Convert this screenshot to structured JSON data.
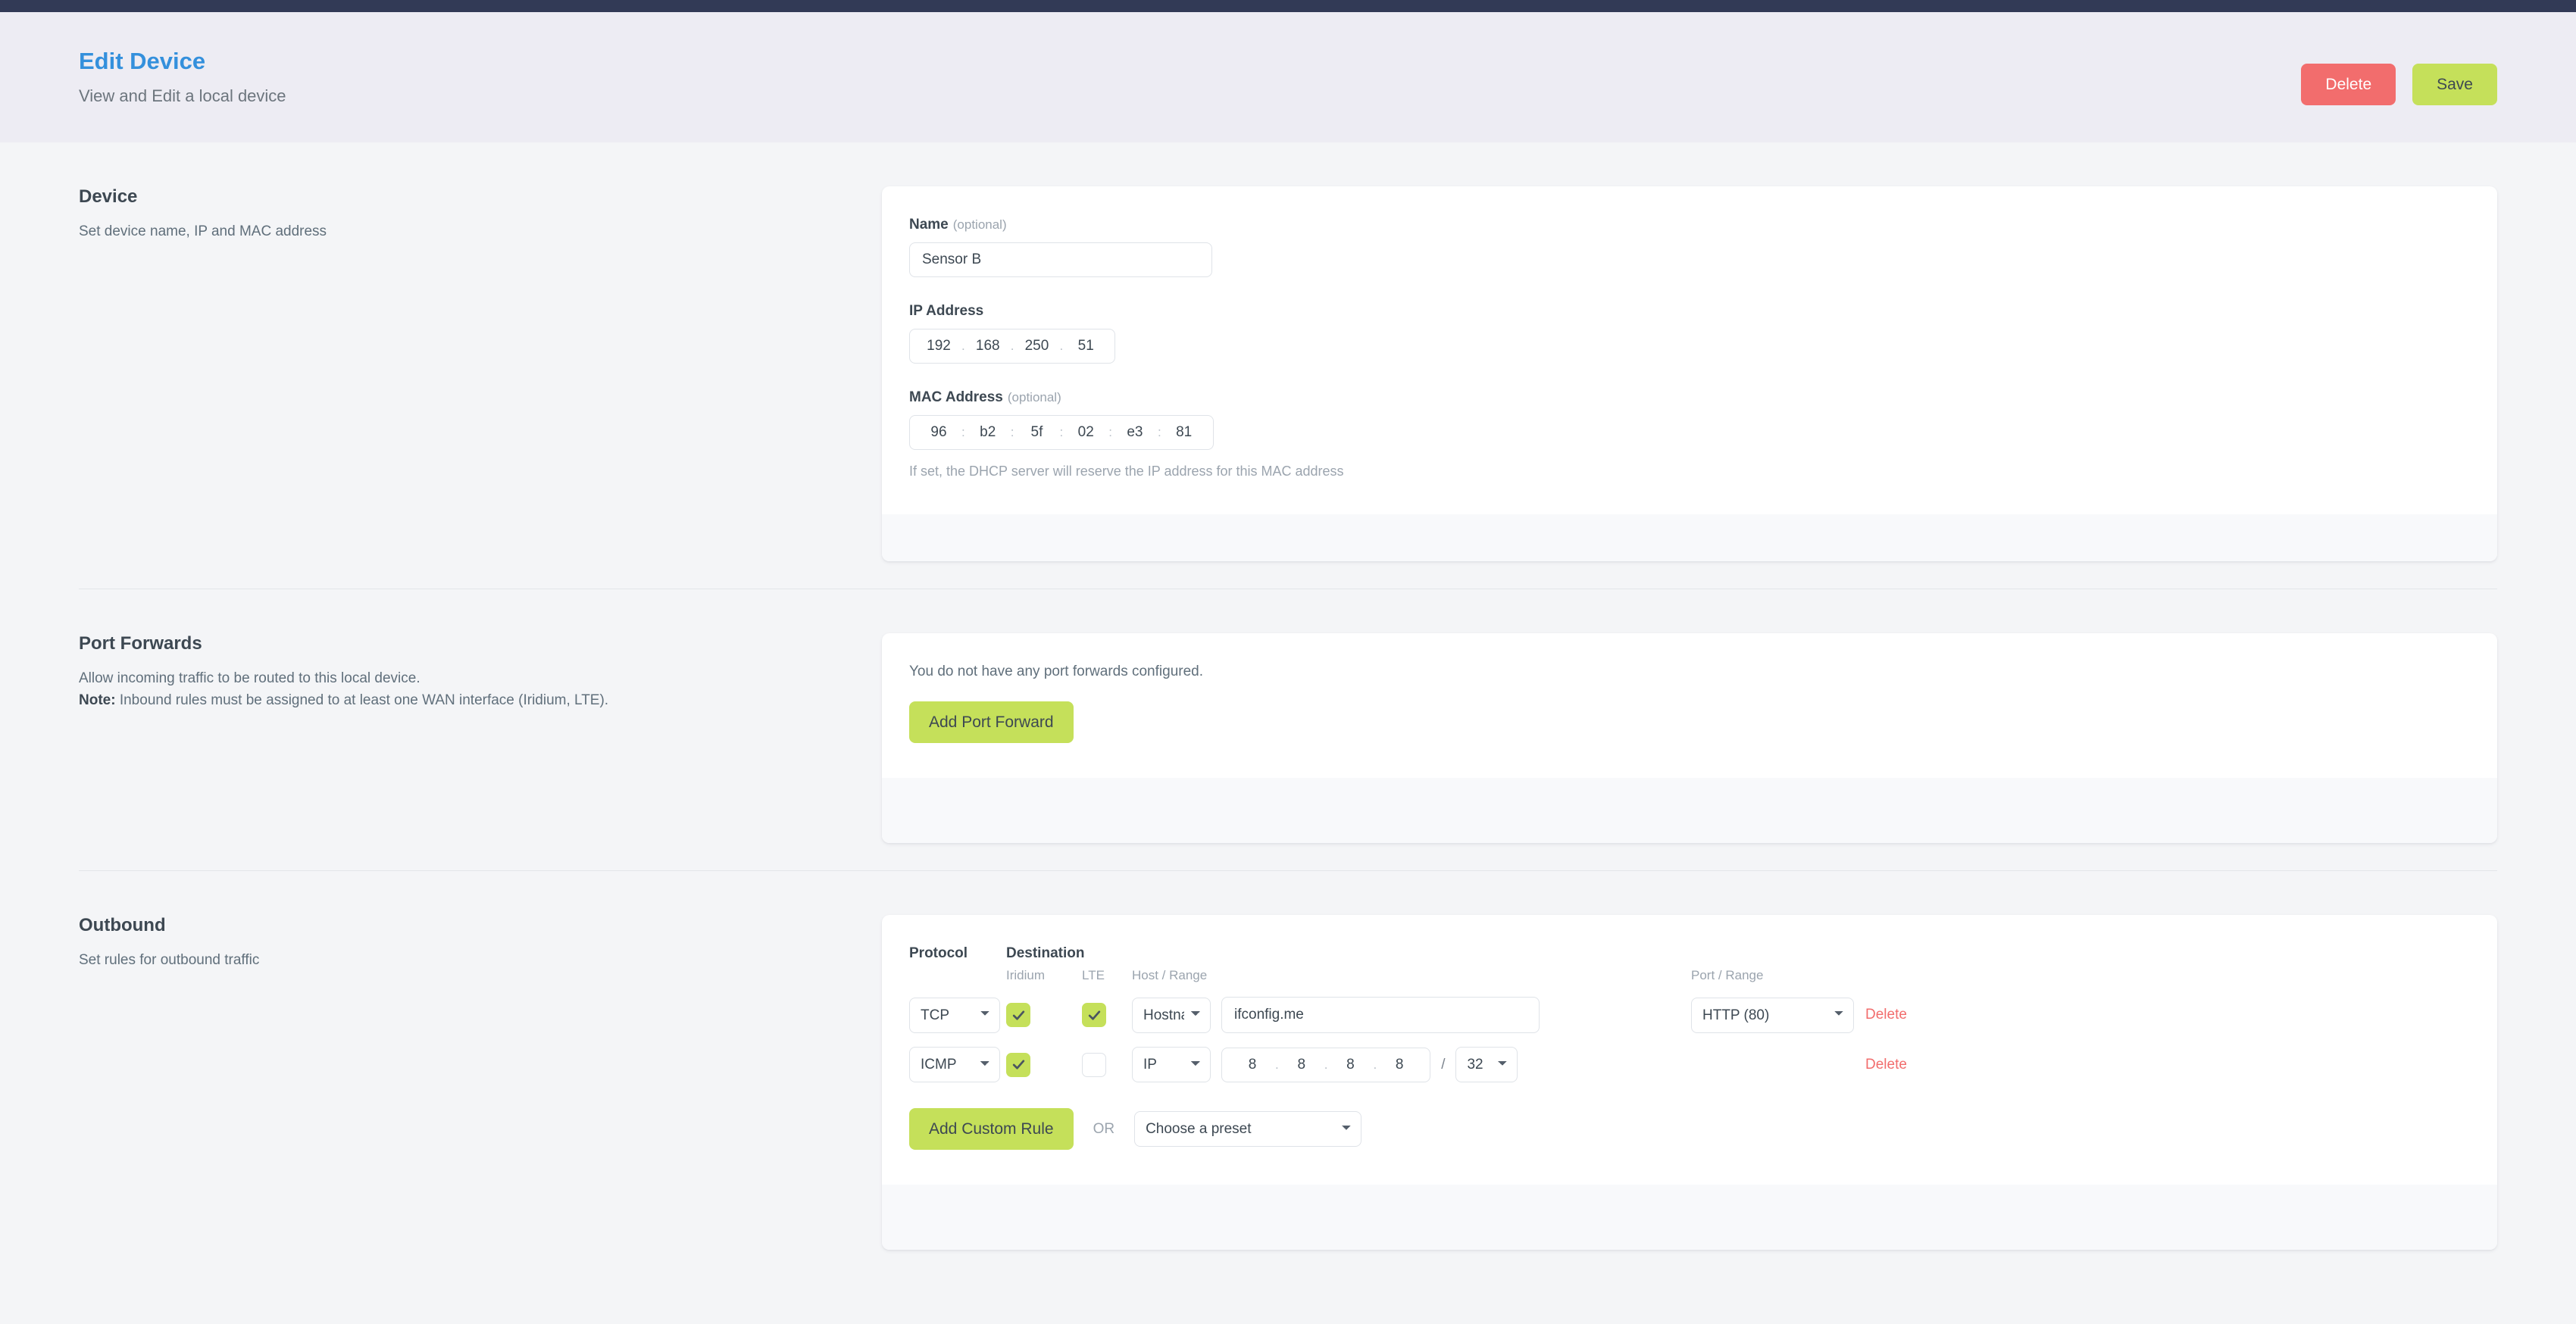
{
  "header": {
    "title": "Edit Device",
    "subtitle": "View and Edit a local device",
    "delete_label": "Delete",
    "save_label": "Save"
  },
  "device": {
    "section_title": "Device",
    "section_desc": "Set device name, IP and MAC address",
    "name_label": "Name",
    "name_optional": "(optional)",
    "name_value": "Sensor B",
    "name_placeholder": "",
    "ip_label": "IP Address",
    "ip_octets": [
      "192",
      "168",
      "250",
      "51"
    ],
    "ip_separator": ".",
    "mac_label": "MAC Address",
    "mac_optional": "(optional)",
    "mac_octets": [
      "96",
      "b2",
      "5f",
      "02",
      "e3",
      "81"
    ],
    "mac_separator": ":",
    "help_text": "If set, the DHCP server will reserve the IP address for this MAC address"
  },
  "port_forwards": {
    "section_title": "Port Forwards",
    "section_desc_line1": "Allow incoming traffic to be routed to this local device.",
    "note_label": "Note:",
    "section_desc_line2": " Inbound rules must be assigned to at least one WAN interface (Iridium, LTE).",
    "empty_text": "You do not have any port forwards configured.",
    "add_label": "Add Port Forward"
  },
  "outbound": {
    "section_title": "Outbound",
    "section_desc": "Set rules for outbound traffic",
    "headers": {
      "protocol": "Protocol",
      "destination": "Destination",
      "iridium": "Iridium",
      "lte": "LTE",
      "host_range": "Host / Range",
      "port_range": "Port / Range"
    },
    "rules": [
      {
        "protocol": "TCP",
        "iridium": true,
        "lte": true,
        "host_type": "Hostname",
        "hostname": "ifconfig.me",
        "port": "HTTP (80)",
        "delete_label": "Delete"
      },
      {
        "protocol": "ICMP",
        "iridium": true,
        "lte": false,
        "host_type": "IP",
        "ip_octets": [
          "8",
          "8",
          "8",
          "8"
        ],
        "ip_separator": ".",
        "cidr_slash": "/",
        "cidr": "32",
        "delete_label": "Delete"
      }
    ],
    "add_custom_label": "Add Custom Rule",
    "or_label": "OR",
    "preset_placeholder": "Choose a preset"
  },
  "colors": {
    "accent_blue": "#3490dc",
    "lime": "#c5e05a",
    "danger": "#f26d6d",
    "topbar": "#323a56",
    "page_bg": "#f4f5f7",
    "header_bg": "#edecf3"
  }
}
